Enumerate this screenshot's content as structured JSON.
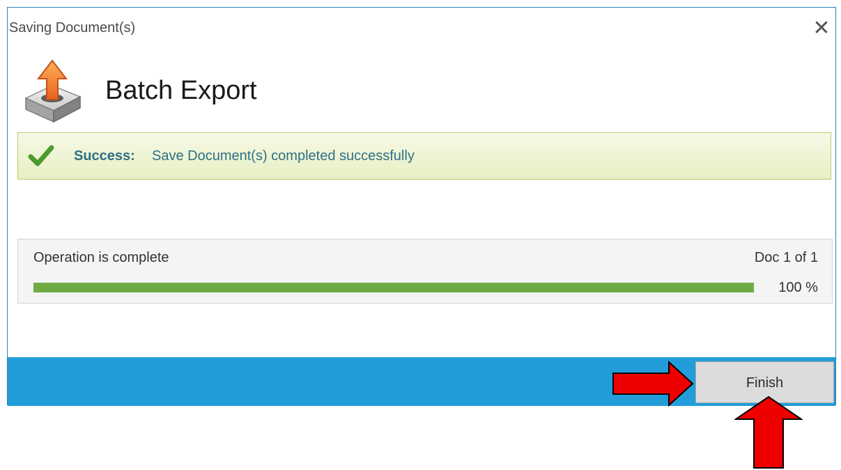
{
  "window": {
    "title": "Saving Document(s)",
    "close_icon": "close-icon",
    "close_glyph": "✕"
  },
  "header": {
    "icon": "export-upload-icon",
    "title": "Batch Export"
  },
  "status": {
    "icon": "checkmark-icon",
    "label": "Success:",
    "message": "Save Document(s) completed successfully",
    "colors": {
      "text": "#2f6f86",
      "border": "#b9cc6e",
      "check": "#4e9a2e"
    }
  },
  "progress": {
    "status_text": "Operation is complete",
    "doc_counter": "Doc 1 of 1",
    "fraction": 1.0,
    "percent_text": "100 %",
    "colors": {
      "fill": "#6fab45",
      "track": "#dcdcdc"
    }
  },
  "footer": {
    "finish_label": "Finish",
    "color": "#229dd9"
  },
  "annotations": {
    "arrow_color": "#ee0000",
    "arrows": [
      "arrow-right-annotation",
      "arrow-up-annotation"
    ]
  }
}
